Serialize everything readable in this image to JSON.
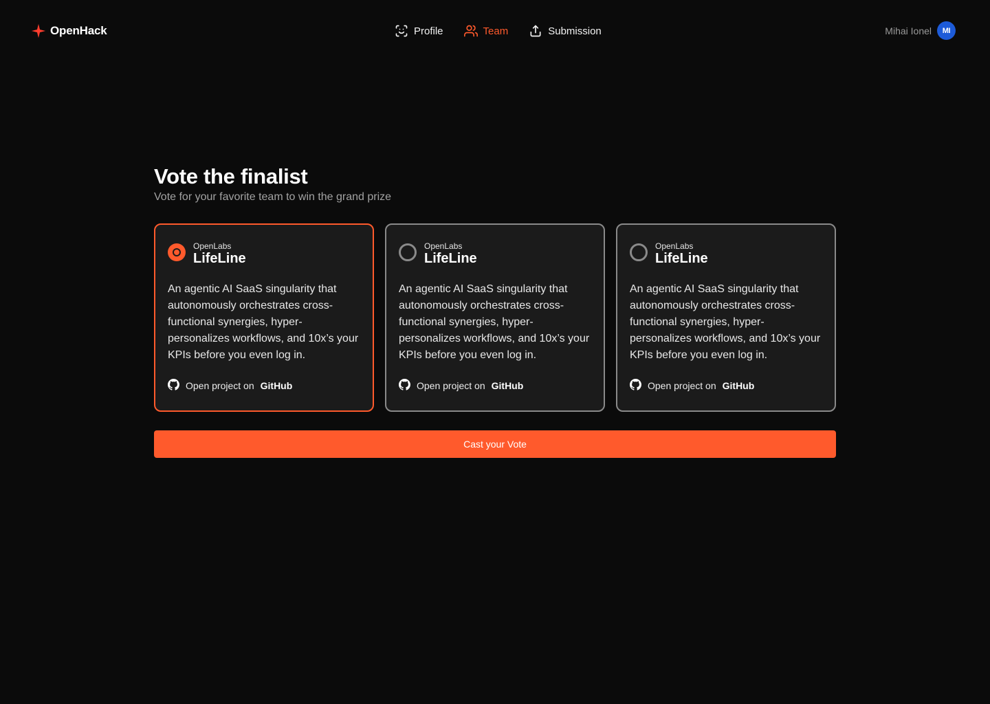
{
  "colors": {
    "accent": "#ff5a2c",
    "avatar_bg": "#1d5bd8",
    "background": "#0b0b0b",
    "card_bg": "#1b1b1b"
  },
  "header": {
    "brand": "OpenHack",
    "nav": [
      {
        "label": "Profile",
        "icon": "face-scan-icon",
        "active": false
      },
      {
        "label": "Team",
        "icon": "users-icon",
        "active": true
      },
      {
        "label": "Submission",
        "icon": "upload-icon",
        "active": false
      }
    ],
    "user": {
      "name": "Mihai Ionel",
      "initials": "MI"
    }
  },
  "main": {
    "title": "Vote the finalist",
    "subtitle": "Vote for your favorite team to win the grand prize",
    "cards": [
      {
        "org": "OpenLabs",
        "project": "LifeLine",
        "description": "An agentic AI SaaS singularity that autonomously orchestrates cross-functional synergies, hyper-personalizes workflows, and 10x’s your KPIs before you even log in.",
        "link_prefix": "Open project on",
        "link_target": "GitHub",
        "selected": true
      },
      {
        "org": "OpenLabs",
        "project": "LifeLine",
        "description": "An agentic AI SaaS singularity that autonomously orchestrates cross-functional synergies, hyper-personalizes workflows, and 10x’s your KPIs before you even log in.",
        "link_prefix": "Open project on",
        "link_target": "GitHub",
        "selected": false
      },
      {
        "org": "OpenLabs",
        "project": "LifeLine",
        "description": "An agentic AI SaaS singularity that autonomously orchestrates cross-functional synergies, hyper-personalizes workflows, and 10x’s your KPIs before you even log in.",
        "link_prefix": "Open project on",
        "link_target": "GitHub",
        "selected": false
      }
    ],
    "vote_button": "Cast your Vote"
  }
}
